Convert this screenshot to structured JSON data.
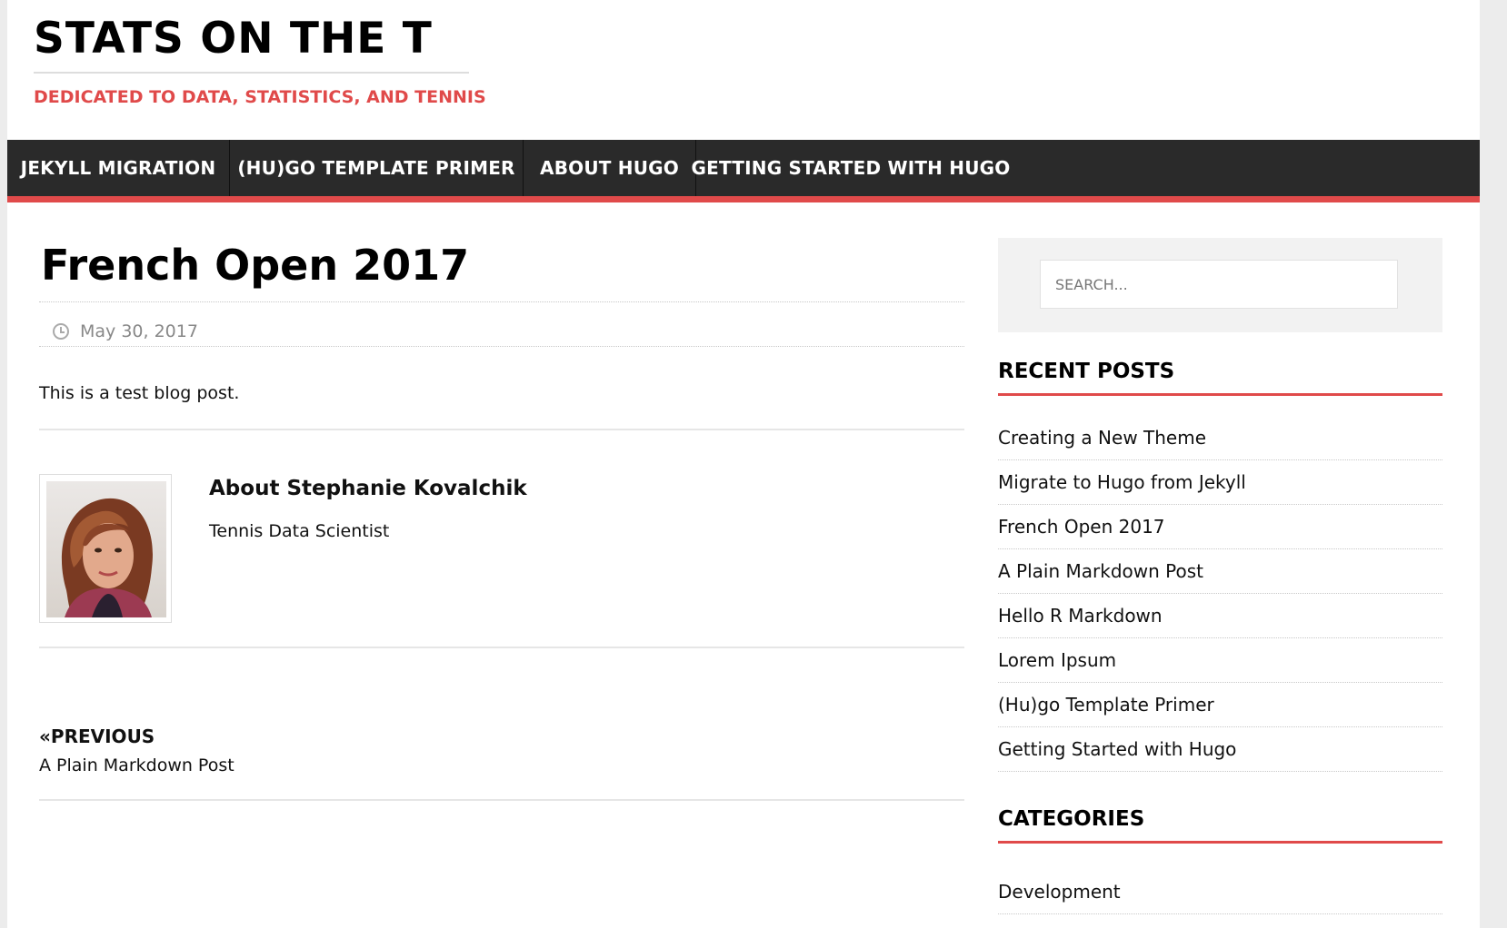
{
  "site": {
    "title": "STATS ON THE T",
    "tagline": "DEDICATED TO DATA, STATISTICS, AND TENNIS"
  },
  "nav": {
    "items": [
      {
        "label": "JEKYLL MIGRATION"
      },
      {
        "label": "(HU)GO TEMPLATE PRIMER"
      },
      {
        "label": "ABOUT HUGO"
      },
      {
        "label": "GETTING STARTED WITH HUGO"
      }
    ]
  },
  "post": {
    "title": "French Open 2017",
    "date": "May 30, 2017",
    "body": "This is a test blog post."
  },
  "author": {
    "name": "About Stephanie Kovalchik",
    "role": "Tennis Data Scientist"
  },
  "pagination": {
    "previous_label": "«PREVIOUS",
    "previous_title": "A Plain Markdown Post"
  },
  "sidebar": {
    "search_placeholder": "SEARCH...",
    "recent_title": "RECENT POSTS",
    "recent_posts": [
      "Creating a New Theme",
      "Migrate to Hugo from Jekyll",
      "French Open 2017",
      "A Plain Markdown Post",
      "Hello R Markdown",
      "Lorem Ipsum",
      "(Hu)go Template Primer",
      "Getting Started with Hugo"
    ],
    "categories_title": "CATEGORIES",
    "categories": [
      "Development"
    ]
  },
  "colors": {
    "accent": "#e04a4a",
    "nav_background": "#2a2a2a",
    "search_panel": "#f2f2f2"
  }
}
